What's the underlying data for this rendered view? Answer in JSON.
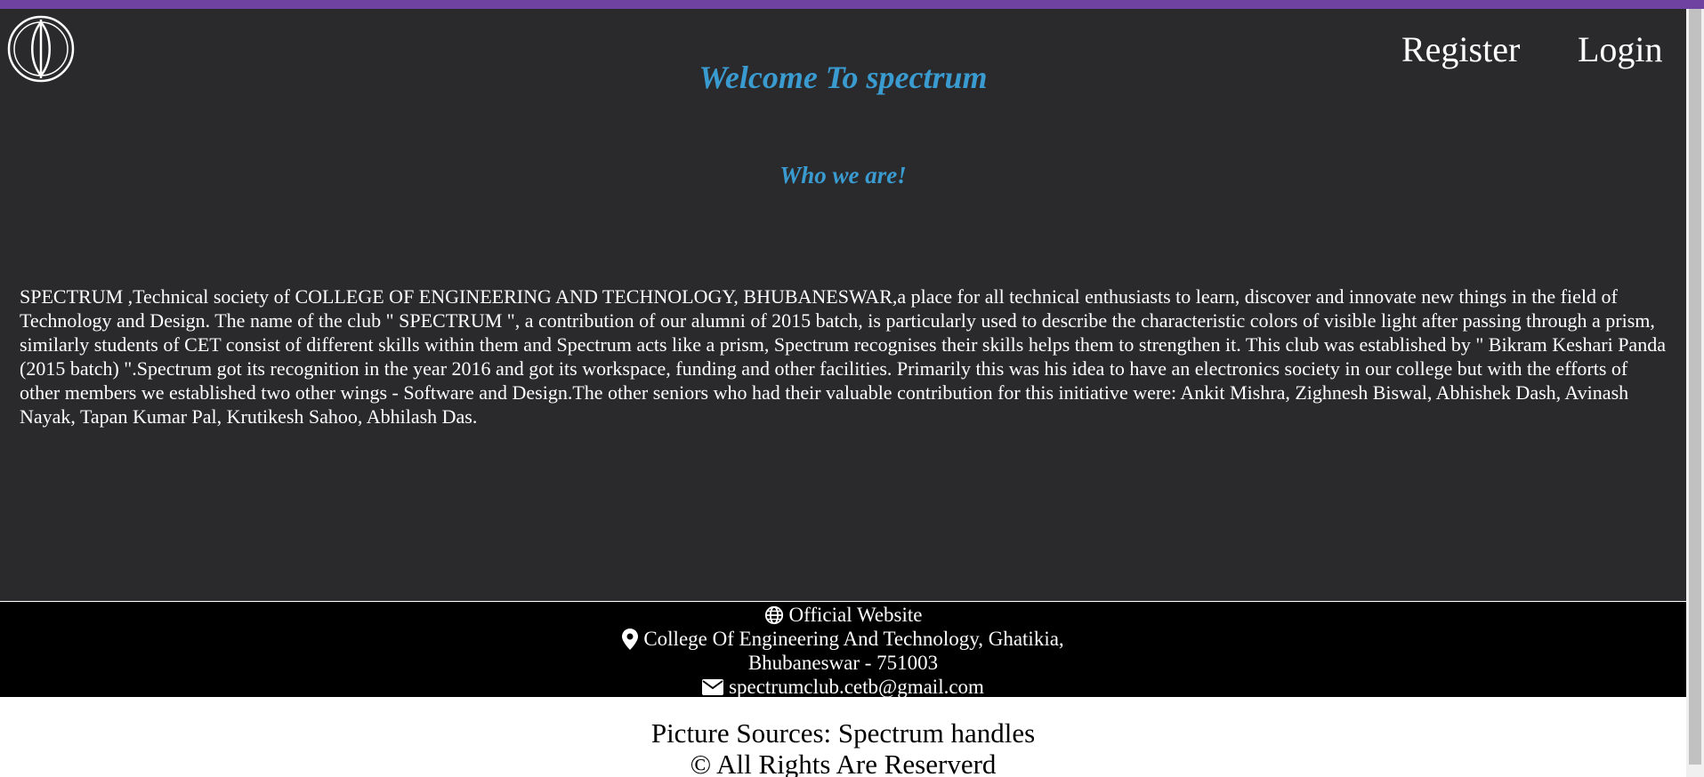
{
  "header": {
    "nav": {
      "register": "Register",
      "login": "Login"
    },
    "title": "Welcome To spectrum"
  },
  "about": {
    "heading": "Who we are!",
    "body": "SPECTRUM ,Technical society of COLLEGE OF ENGINEERING AND TECHNOLOGY, BHUBANESWAR,a place for all technical enthusiasts to learn, discover and innovate new things in the field of Technology and Design. The name of the club \" SPECTRUM \", a contribution of our alumni of 2015 batch, is particularly used to describe the characteristic colors of visible light after passing through a prism, similarly students of CET consist of different skills within them and Spectrum acts like a prism, Spectrum recognises their skills helps them to strengthen it. This club was established by \" Bikram Keshari Panda (2015 batch) \".Spectrum got its recognition in the year 2016 and got its workspace, funding and other facilities. Primarily this was his idea to have an electronics society in our college but with the efforts of other members we established two other wings - Software and Design.The other seniors who had their valuable contribution for this initiative were: Ankit Mishra, Zighnesh Biswal, Abhishek Dash, Avinash Nayak, Tapan Kumar Pal, Krutikesh Sahoo, Abhilash Das."
  },
  "footer": {
    "website": "Official Website",
    "address_line1": "College Of Engineering And Technology, Ghatikia,",
    "address_line2": "Bhubaneswar - 751003",
    "email": "spectrumclub.cetb@gmail.com",
    "icons": [
      "globe-icon",
      "map-marker-icon",
      "envelope-icon"
    ]
  },
  "credits": {
    "sources": "Picture Sources: Spectrum handles",
    "rights": "© All Rights Are Reserverd"
  },
  "colors": {
    "accent_bar": "#6f42a1",
    "heading": "#3a9bd1",
    "background": "#2a2a2c",
    "footer_bg": "#000000"
  }
}
